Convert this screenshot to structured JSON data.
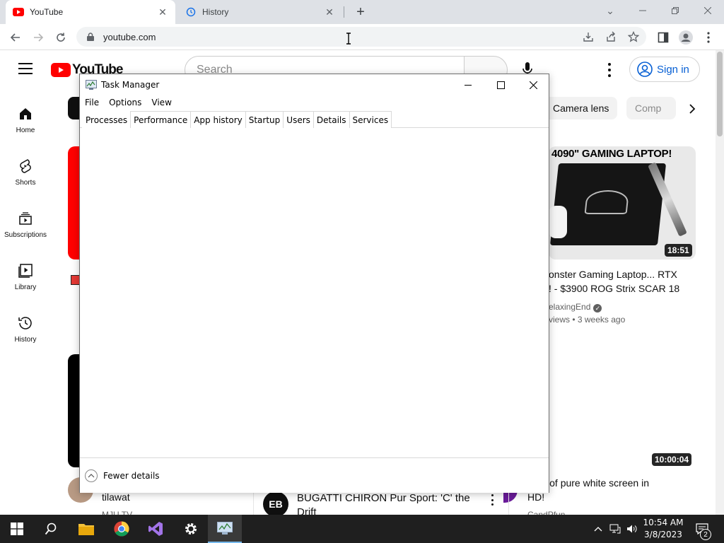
{
  "browser": {
    "tabs": [
      {
        "title": "YouTube",
        "favicon": "youtube-icon",
        "active": true
      },
      {
        "title": "History",
        "favicon": "history-icon",
        "active": false
      }
    ],
    "url": "youtube.com"
  },
  "youtube": {
    "logo_text": "YouTube",
    "search_placeholder": "Search",
    "sign_in": "Sign in",
    "sidebar": [
      {
        "label": "Home",
        "icon": "home-icon"
      },
      {
        "label": "Shorts",
        "icon": "shorts-icon"
      },
      {
        "label": "Subscriptions",
        "icon": "subscriptions-icon"
      },
      {
        "label": "Library",
        "icon": "library-icon"
      },
      {
        "label": "History",
        "icon": "history-icon"
      }
    ],
    "chips": [
      "Camera lens",
      "Comp"
    ],
    "videos": [
      {
        "thumb_headline": "4090\" GAMING LAPTOP!",
        "duration": "18:51",
        "title_line1": "onster Gaming Laptop... RTX",
        "title_line2": "! - $3900 ROG Strix SCAR 18",
        "channel": "elaxingEnd",
        "meta": "views • 3 weeks ago"
      },
      {
        "duration": "10:00:04",
        "title_line1": "ours of pure white screen in",
        "title_line2": "HD!",
        "channel": "CandPfun"
      },
      {
        "title_line1": "tilawat",
        "channel": "MJU TV"
      },
      {
        "title_line1": "BUGATTI CHIRON Pur Sport: 'C' the",
        "title_line2": "Drift"
      }
    ],
    "accent_color": "#ff0000",
    "link_color": "#065fd4"
  },
  "task_manager": {
    "title": "Task Manager",
    "menu": [
      "File",
      "Options",
      "View"
    ],
    "tabs": [
      "Processes",
      "Performance",
      "App history",
      "Startup",
      "Users",
      "Details",
      "Services"
    ],
    "selected_tab": "Processes",
    "footer": "Fewer details"
  },
  "taskbar": {
    "time": "10:54 AM",
    "date": "3/8/2023",
    "notifications": "2",
    "apps": [
      "file-explorer-icon",
      "chrome-icon",
      "visual-studio-icon",
      "settings-icon",
      "task-manager-icon"
    ]
  }
}
